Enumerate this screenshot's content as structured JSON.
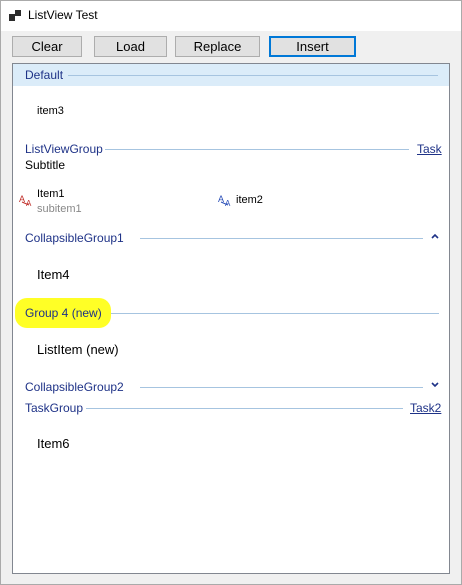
{
  "window": {
    "title": "ListView Test"
  },
  "toolbar": {
    "clear": "Clear",
    "load": "Load",
    "replace": "Replace",
    "insert": "Insert"
  },
  "groups": {
    "default": {
      "title": "Default",
      "items": [
        "item3"
      ]
    },
    "listviewgroup": {
      "title": "ListViewGroup",
      "task": "Task",
      "subtitle": "Subtitle",
      "items": [
        {
          "text": "Item1",
          "subitem": "subitem1"
        },
        {
          "text": "item2"
        }
      ]
    },
    "collapsible1": {
      "title": "CollapsibleGroup1",
      "items": [
        "Item4"
      ],
      "state": "expanded"
    },
    "group4": {
      "title": "Group 4 (new)",
      "items": [
        "ListItem (new)"
      ],
      "highlighted": true
    },
    "collapsible2": {
      "title": "CollapsibleGroup2",
      "state": "collapsed"
    },
    "taskgroup": {
      "title": "TaskGroup",
      "task": "Task2",
      "items": [
        "Item6"
      ]
    }
  },
  "colors": {
    "group_header_text": "#1e3287",
    "selected_header_bg": "#dbecf9",
    "focus_border": "#0078d7",
    "highlight": "#ffff00"
  },
  "icons": {
    "item1_icon": "red-a-icon",
    "item2_icon": "blue-a-icon",
    "collapsible1_icon": "chevron-up-icon",
    "collapsible2_icon": "chevron-down-icon"
  }
}
